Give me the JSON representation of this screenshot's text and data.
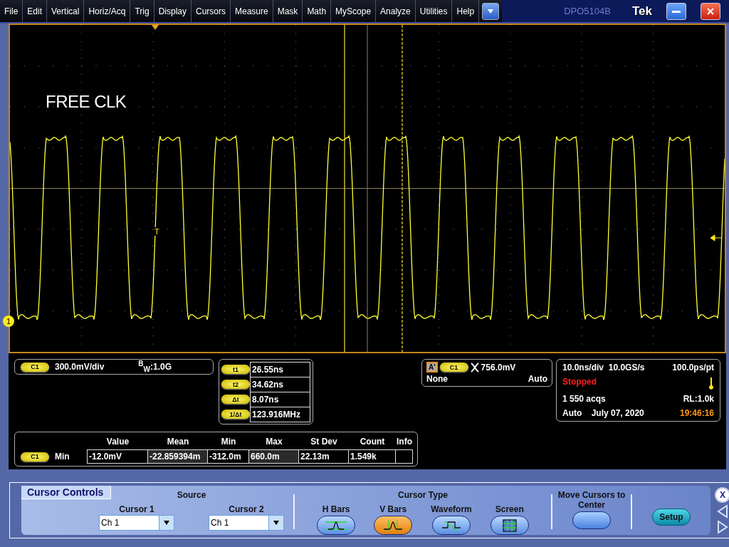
{
  "menu": {
    "items": [
      "File",
      "Edit",
      "Vertical",
      "Horiz/Acq",
      "Trig",
      "Display",
      "Cursors",
      "Measure",
      "Mask",
      "Math",
      "MyScope",
      "Analyze",
      "Utilities",
      "Help"
    ],
    "model": "DPO5104B",
    "brand": "Tek"
  },
  "screen": {
    "label": "FREE CLK",
    "channel_marker": "1",
    "trigger_marker": "T"
  },
  "channel_readout": {
    "badge": "C1",
    "scale": "300.0mV/div",
    "bandwidth": "$^{B}$$_{W}$:1.0G"
  },
  "cursor_readout": [
    {
      "badge": "t1",
      "value": "26.55ns"
    },
    {
      "badge": "t2",
      "value": "34.62ns"
    },
    {
      "badge": "Δt",
      "value": "8.07ns"
    },
    {
      "badge": "1/Δt",
      "value": "123.916MHz"
    }
  ],
  "trigger_readout": {
    "source": "A'",
    "badge": "C1",
    "level": "756.0mV",
    "coupling": "None",
    "mode": "Auto"
  },
  "acquisition": {
    "scale": "10.0ns/div",
    "rate": "10.0GS/s",
    "resolution": "100.0ps/pt",
    "status": "Stopped",
    "acqs": "1 550 acqs",
    "record": "RL:1.0k",
    "mode": "Auto",
    "date": "July 07, 2020",
    "time": "19:46:16"
  },
  "measurements": {
    "columns": [
      "Value",
      "Mean",
      "Min",
      "Max",
      "St Dev",
      "Count",
      "Info"
    ],
    "rows": [
      {
        "badge": "C1",
        "name": "Min",
        "cells": [
          "-12.0mV",
          "-22.859394m",
          "-312.0m",
          "660.0m",
          "22.13m",
          "1.549k"
        ]
      }
    ]
  },
  "cursor_controls": {
    "title": "Cursor Controls",
    "source_heading": "Source",
    "sources": [
      {
        "label": "Cursor 1",
        "value": "Ch 1"
      },
      {
        "label": "Cursor 2",
        "value": "Ch 1"
      }
    ],
    "type_heading": "Cursor Type",
    "types": [
      {
        "label": "H Bars",
        "kind": "hbars",
        "selected": false
      },
      {
        "label": "V Bars",
        "kind": "vbars",
        "selected": true
      },
      {
        "label": "Waveform",
        "kind": "waveform",
        "selected": false
      },
      {
        "label": "Screen",
        "kind": "screen",
        "selected": false
      }
    ],
    "move": "Move Cursors to Center",
    "setup": "Setup",
    "close": "X"
  }
}
